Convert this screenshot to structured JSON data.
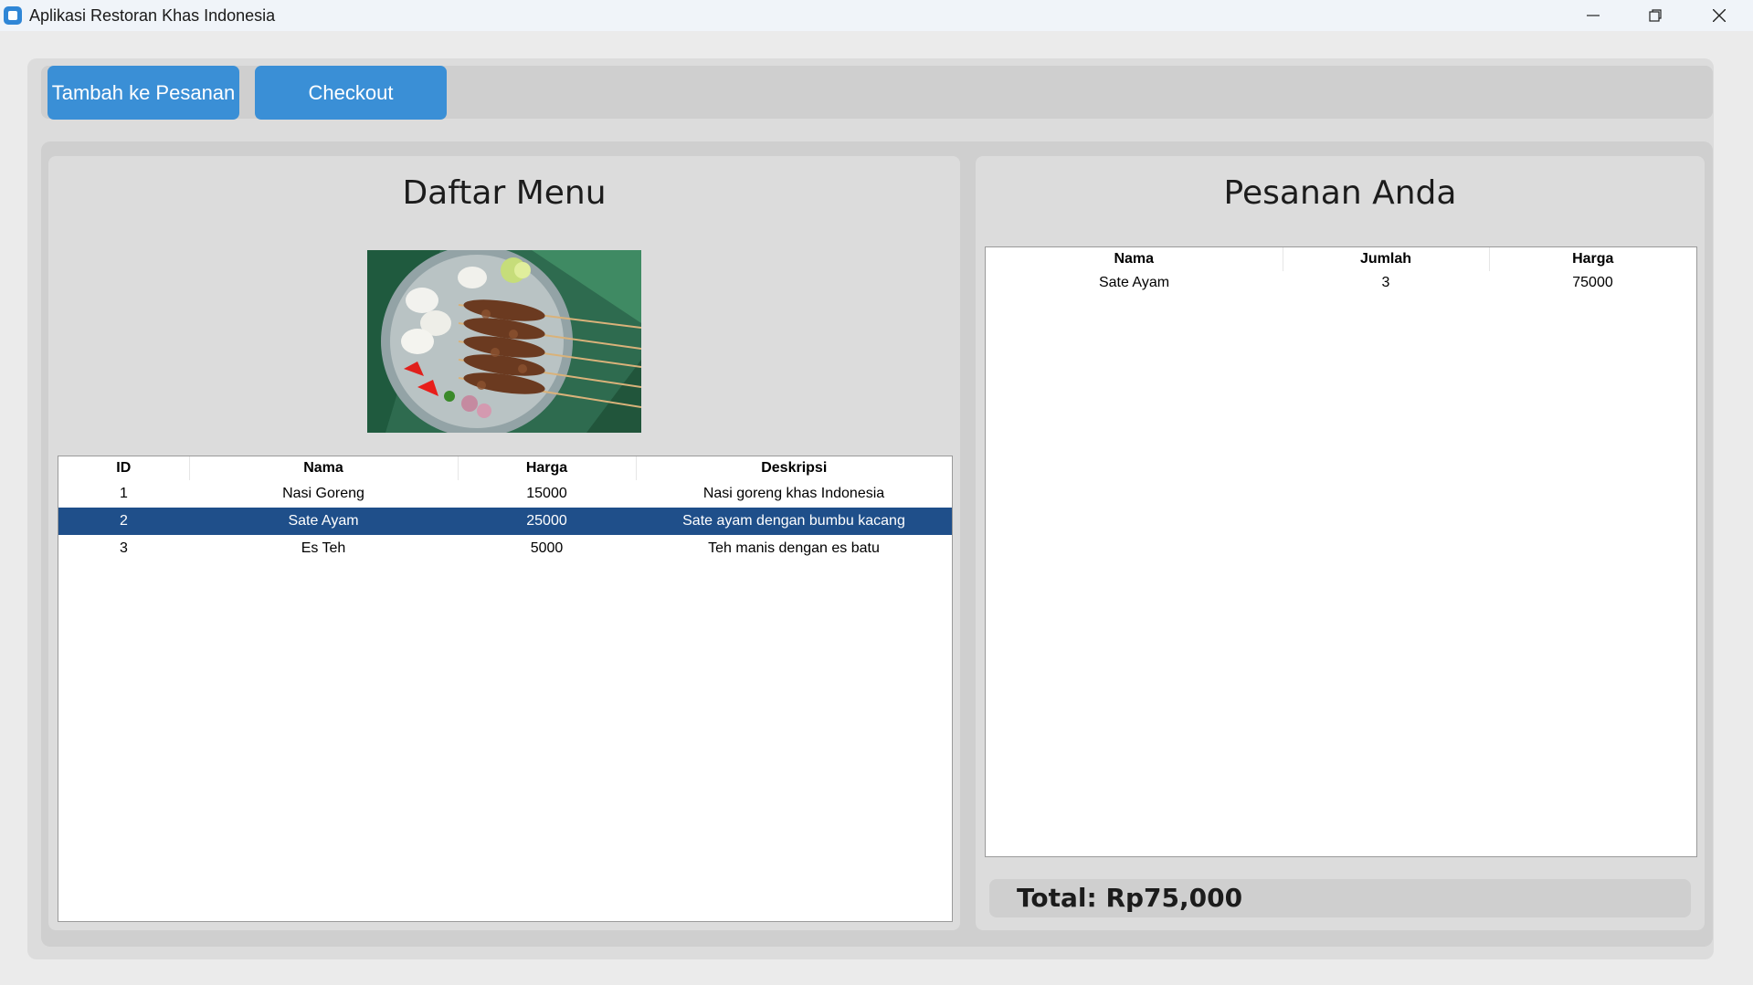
{
  "window": {
    "title": "Aplikasi Restoran Khas Indonesia",
    "icons": [
      "app-icon",
      "minimize-icon",
      "maximize-icon",
      "close-icon"
    ]
  },
  "toolbar": {
    "add_label": "Tambah ke Pesanan",
    "checkout_label": "Checkout"
  },
  "menu": {
    "title": "Daftar Menu",
    "columns": [
      "ID",
      "Nama",
      "Harga",
      "Deskripsi"
    ],
    "rows": [
      [
        "1",
        "Nasi Goreng",
        "15000",
        "Nasi goreng khas Indonesia"
      ],
      [
        "2",
        "Sate Ayam",
        "25000",
        "Sate ayam dengan bumbu kacang"
      ],
      [
        "3",
        "Es Teh",
        "5000",
        "Teh manis dengan es batu"
      ]
    ],
    "selected_index": 1
  },
  "order": {
    "title": "Pesanan Anda",
    "columns": [
      "Nama",
      "Jumlah",
      "Harga"
    ],
    "rows": [
      [
        "Sate Ayam",
        "3",
        "75000"
      ]
    ],
    "total": "Total: Rp75,000"
  },
  "colors": {
    "accent": "#3a8fd6",
    "selected_row": "#1f4f8a"
  }
}
